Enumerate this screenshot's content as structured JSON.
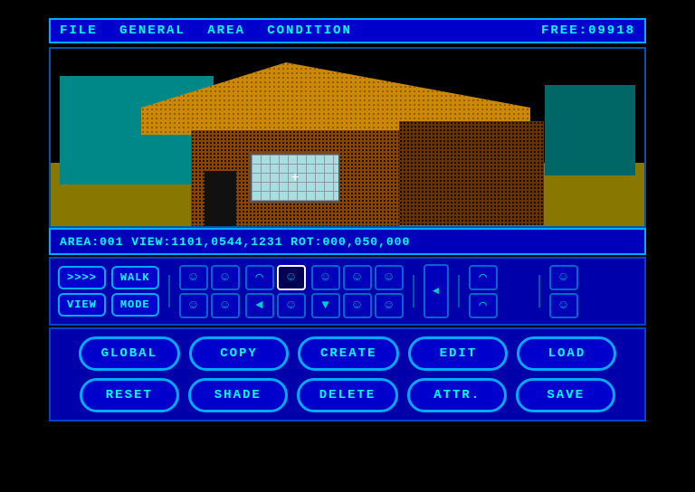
{
  "menu": {
    "items": [
      "FILE",
      "GENERAL",
      "AREA",
      "CONDITION"
    ],
    "free_label": "FREE:09918"
  },
  "status": {
    "text": "AREA:001  VIEW:1101,0544,1231  ROT:000,050,000"
  },
  "controls": {
    "nav_btn": ">>>>",
    "walk_btn": "WALK",
    "view_btn": "VIEW",
    "mode_btn": "MODE"
  },
  "icons": {
    "face1": "☺",
    "face2": "◄",
    "face3": "►",
    "arrow_left": "◄",
    "arrow_right": "►",
    "arrow_up": "▲",
    "arrow_down": "▼"
  },
  "actions": {
    "row1": [
      "GLOBAL",
      "COPY",
      "CREATE",
      "EDIT",
      "LOAD"
    ],
    "row2": [
      "RESET",
      "SHADE",
      "DELETE",
      "ATTR.",
      "SAVE"
    ]
  }
}
